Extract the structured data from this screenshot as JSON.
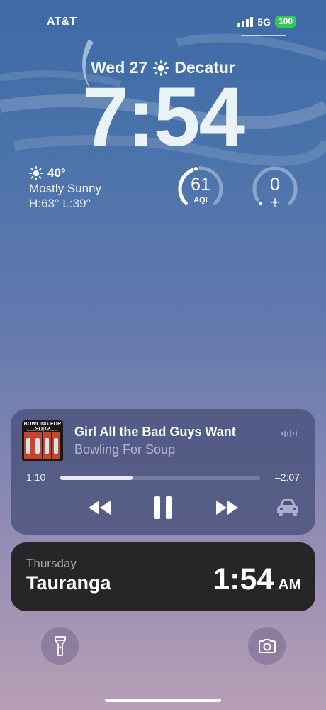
{
  "status_bar": {
    "carrier": "AT&T",
    "network": "5G",
    "battery": "100",
    "signal_bars": 4
  },
  "lock": {
    "date": "Wed 27",
    "location": "Decatur",
    "time": "7:54"
  },
  "weather": {
    "temp": "40°",
    "condition": "Mostly Sunny",
    "hi_lo": "H:63° L:39°"
  },
  "gauges": [
    {
      "value": "61",
      "label": "AQI",
      "level": 0.45
    },
    {
      "value": "0",
      "label": "uv",
      "level": 0.0
    }
  ],
  "now_playing": {
    "song": "Girl All the Bad Guys Want",
    "artist": "Bowling For Soup",
    "album_art_text": "BOWLING FOR SOUP",
    "album_art_subtext": "Drunk Enough To Dance",
    "elapsed": "1:10",
    "remaining": "–2:07",
    "progress": 0.36
  },
  "world_clock": {
    "day": "Thursday",
    "city": "Tauranga",
    "time": "1:54",
    "ampm": "AM"
  },
  "colors": {
    "battery": "#34c759",
    "clock_widget_bg": "#262527",
    "player_bg": "#4a537d"
  },
  "icons": [
    "signal-bars-icon",
    "sun-icon",
    "rewind-icon",
    "pause-icon",
    "fast-forward-icon",
    "car-icon",
    "flashlight-icon",
    "camera-icon",
    "waveform-icon"
  ]
}
